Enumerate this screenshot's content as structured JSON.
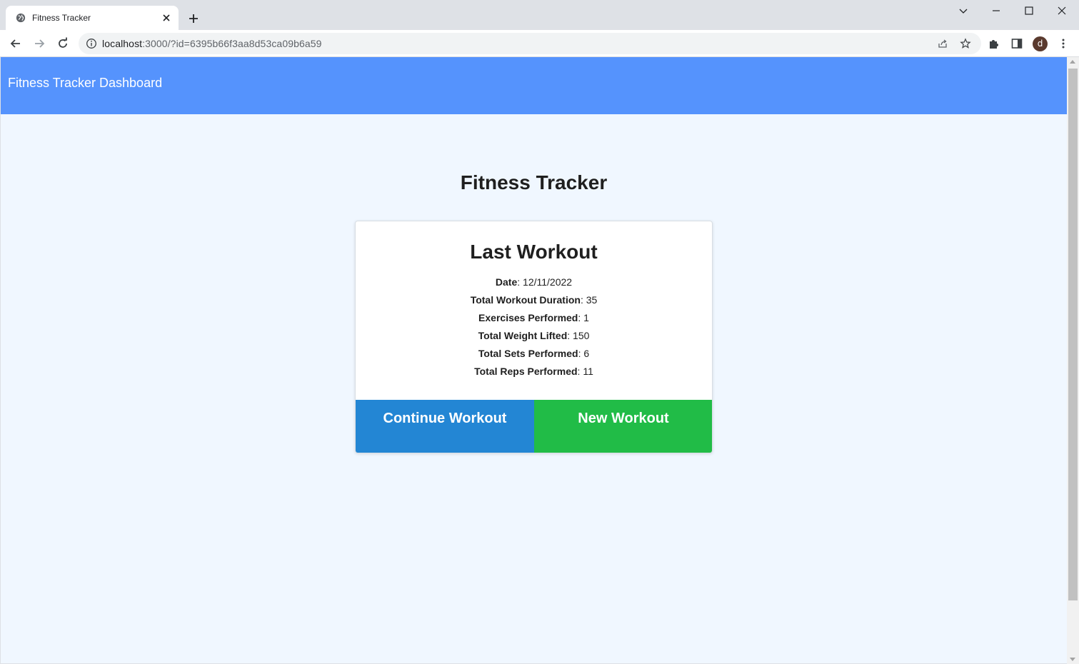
{
  "browser": {
    "tab_title": "Fitness Tracker",
    "url_host": "localhost",
    "url_rest": ":3000/?id=6395b66f3aa8d53ca09b6a59",
    "avatar_letter": "d",
    "icons": {
      "favicon": "globe-icon",
      "tab_close": "close-icon",
      "new_tab": "plus-icon",
      "back": "arrow-left-icon",
      "forward": "arrow-right-icon",
      "reload": "reload-icon",
      "site_info": "info-icon",
      "share": "share-icon",
      "bookmark": "star-icon",
      "extensions": "puzzle-icon",
      "side_panel": "side-panel-icon",
      "menu": "kebab-menu-icon"
    }
  },
  "navbar": {
    "brand": "Fitness Tracker Dashboard",
    "color": "#5593fd"
  },
  "main": {
    "title": "Fitness Tracker"
  },
  "last_workout": {
    "title": "Last Workout",
    "stats": [
      {
        "label": "Date",
        "value": "12/11/2022"
      },
      {
        "label": "Total Workout Duration",
        "value": "35"
      },
      {
        "label": "Exercises Performed",
        "value": "1"
      },
      {
        "label": "Total Weight Lifted",
        "value": "150"
      },
      {
        "label": "Total Sets Performed",
        "value": "6"
      },
      {
        "label": "Total Reps Performed",
        "value": "11"
      }
    ],
    "continue_label": "Continue Workout",
    "new_label": "New Workout",
    "continue_color": "#2386d4",
    "new_color": "#21bc47"
  }
}
